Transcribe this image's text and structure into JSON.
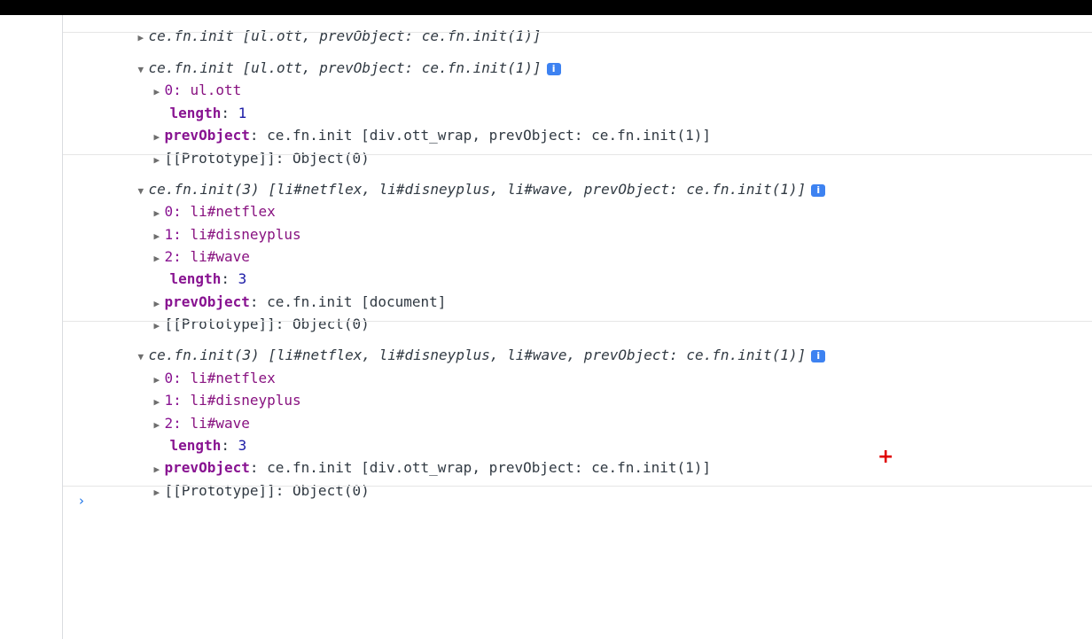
{
  "entries": [
    {
      "summary_prefix": "ce.fn.init ",
      "summary_items": "[ul.ott, prevObject: ce.fn.init(1)]",
      "collapsed": true
    },
    {
      "summary_prefix": "ce.fn.init ",
      "summary_items": "[ul.ott, prevObject: ce.fn.init(1)]",
      "info": "i",
      "rows": [
        {
          "key": "0",
          "sep": ": ",
          "value": "ul.ott"
        },
        {
          "key": "length",
          "sep": ": ",
          "value": "1"
        },
        {
          "key": "prevObject",
          "sep": ": ",
          "value": "ce.fn.init [div.ott_wrap, prevObject: ce.fn.init(1)]"
        },
        {
          "key": "[[Prototype]]",
          "sep": ": ",
          "value": "Object(0)"
        }
      ]
    },
    {
      "summary_prefix": "ce.fn.init(3) ",
      "summary_items": "[li#netflex, li#disneyplus, li#wave, prevObject: ce.fn.init(1)]",
      "info": "i",
      "rows": [
        {
          "key": "0",
          "sep": ": ",
          "value": "li#netflex"
        },
        {
          "key": "1",
          "sep": ": ",
          "value": "li#disneyplus"
        },
        {
          "key": "2",
          "sep": ": ",
          "value": "li#wave"
        },
        {
          "key": "length",
          "sep": ": ",
          "value": "3"
        },
        {
          "key": "prevObject",
          "sep": ": ",
          "value": "ce.fn.init [document]"
        },
        {
          "key": "[[Prototype]]",
          "sep": ": ",
          "value": "Object(0)"
        }
      ]
    },
    {
      "summary_prefix": "ce.fn.init(3) ",
      "summary_items": "[li#netflex, li#disneyplus, li#wave, prevObject: ce.fn.init(1)]",
      "info": "i",
      "rows": [
        {
          "key": "0",
          "sep": ": ",
          "value": "li#netflex"
        },
        {
          "key": "1",
          "sep": ": ",
          "value": "li#disneyplus"
        },
        {
          "key": "2",
          "sep": ": ",
          "value": "li#wave"
        },
        {
          "key": "length",
          "sep": ": ",
          "value": "3"
        },
        {
          "key": "prevObject",
          "sep": ": ",
          "value": "ce.fn.init [div.ott_wrap, prevObject: ce.fn.init(1)]"
        },
        {
          "key": "[[Prototype]]",
          "sep": ": ",
          "value": "Object(0)"
        }
      ]
    }
  ],
  "prompt": {
    "symbol": "›"
  },
  "icons": {
    "collapsed": "triangle-right-icon",
    "expanded": "triangle-down-icon",
    "info": "info-icon",
    "cursor": "crosshair-icon"
  },
  "colors": {
    "key": "#881391",
    "value": "#1a1aa6",
    "info_badge": "#3d82f1",
    "prompt": "#1a73e8",
    "cursor": "#e00000"
  },
  "cursor_symbol": "+"
}
